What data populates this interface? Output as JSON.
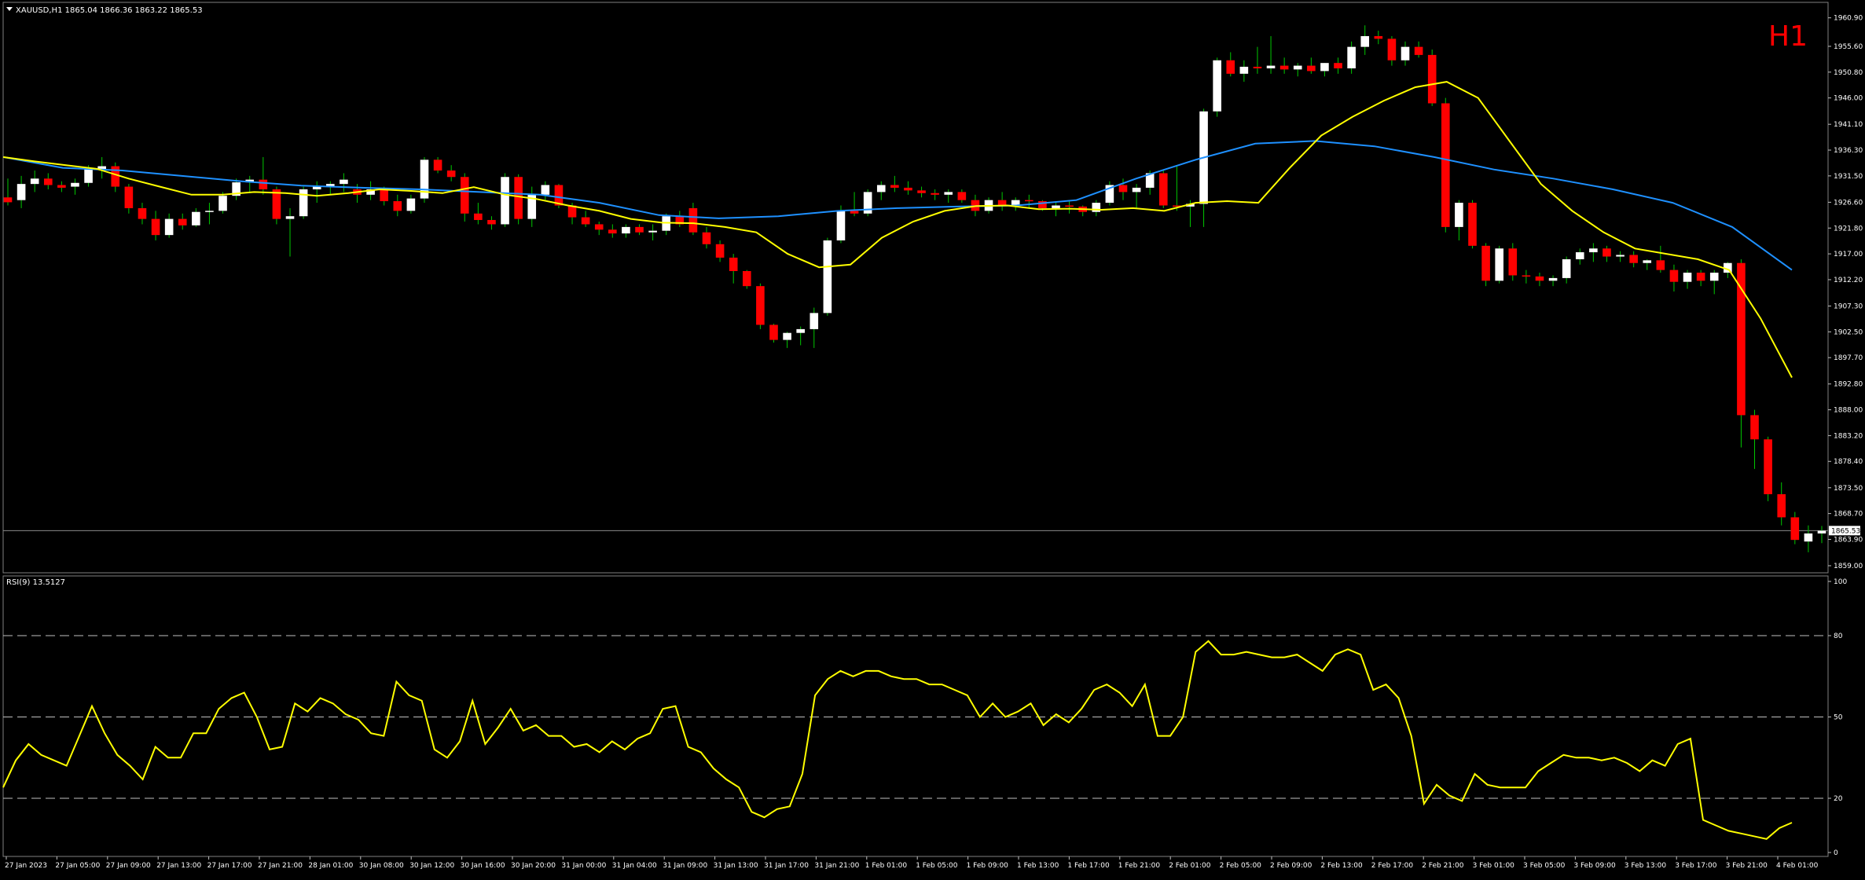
{
  "header": {
    "symbol_line": "XAUUSD,H1  1865.04 1866.36 1863.22 1865.53",
    "timeframe": "H1"
  },
  "price_axis": {
    "ticks": [
      "1960.90",
      "1955.60",
      "1950.80",
      "1946.00",
      "1941.10",
      "1936.30",
      "1931.50",
      "1926.60",
      "1921.80",
      "1917.00",
      "1912.20",
      "1907.30",
      "1902.50",
      "1897.70",
      "1892.80",
      "1888.00",
      "1883.20",
      "1878.40",
      "1873.50",
      "1868.70",
      "1863.90",
      "1859.00"
    ],
    "current_price": "1865.53"
  },
  "rsi": {
    "label": "RSI(9) 13.5127",
    "ticks": [
      "100",
      "80",
      "50",
      "20",
      "0"
    ],
    "levels": [
      80,
      50,
      20
    ]
  },
  "time_axis": {
    "labels": [
      "27 Jan 2023",
      "27 Jan 05:00",
      "27 Jan 09:00",
      "27 Jan 13:00",
      "27 Jan 17:00",
      "27 Jan 21:00",
      "28 Jan 01:00",
      "30 Jan 08:00",
      "30 Jan 12:00",
      "30 Jan 16:00",
      "30 Jan 20:00",
      "31 Jan 00:00",
      "31 Jan 04:00",
      "31 Jan 09:00",
      "31 Jan 13:00",
      "31 Jan 17:00",
      "31 Jan 21:00",
      "1 Feb 01:00",
      "1 Feb 05:00",
      "1 Feb 09:00",
      "1 Feb 13:00",
      "1 Feb 17:00",
      "1 Feb 21:00",
      "2 Feb 01:00",
      "2 Feb 05:00",
      "2 Feb 09:00",
      "2 Feb 13:00",
      "2 Feb 17:00",
      "2 Feb 21:00",
      "3 Feb 01:00",
      "3 Feb 05:00",
      "3 Feb 09:00",
      "3 Feb 13:00",
      "3 Feb 17:00",
      "3 Feb 21:00",
      "4 Feb 01:00"
    ]
  },
  "colors": {
    "background": "#000000",
    "bull_candle": "#ffffff",
    "bear_candle": "#ff0000",
    "wick": "#00c800",
    "fast_ma": "#ffff00",
    "slow_ma": "#1e90ff",
    "rsi_line": "#ffff00",
    "timeframe_label": "#ff0000",
    "grid_level": "#c0c0c0"
  },
  "chart_data": {
    "type": "candlestick",
    "symbol": "XAUUSD",
    "timeframe": "H1",
    "ylim": [
      1859.0,
      1962.0
    ],
    "candles": [
      [
        1927.5,
        1931.0,
        1926.0,
        1926.6
      ],
      [
        1927.0,
        1931.5,
        1925.5,
        1930.0
      ],
      [
        1930.0,
        1932.5,
        1928.5,
        1931.0
      ],
      [
        1931.0,
        1932.0,
        1929.0,
        1929.8
      ],
      [
        1929.8,
        1930.5,
        1928.5,
        1929.3
      ],
      [
        1929.5,
        1931.0,
        1928.0,
        1930.2
      ],
      [
        1930.2,
        1933.5,
        1929.5,
        1932.8
      ],
      [
        1932.8,
        1935.0,
        1931.0,
        1933.3
      ],
      [
        1933.3,
        1934.0,
        1928.5,
        1929.5
      ],
      [
        1929.5,
        1930.0,
        1924.5,
        1925.5
      ],
      [
        1925.5,
        1926.5,
        1922.5,
        1923.5
      ],
      [
        1923.5,
        1925.0,
        1919.5,
        1920.5
      ],
      [
        1920.5,
        1924.5,
        1920.0,
        1923.5
      ],
      [
        1923.5,
        1924.5,
        1921.5,
        1922.3
      ],
      [
        1922.3,
        1925.5,
        1922.0,
        1924.8
      ],
      [
        1924.8,
        1926.5,
        1922.5,
        1925.0
      ],
      [
        1925.0,
        1928.5,
        1924.5,
        1927.8
      ],
      [
        1927.8,
        1931.0,
        1927.0,
        1930.3
      ],
      [
        1930.3,
        1931.5,
        1928.5,
        1930.8
      ],
      [
        1930.8,
        1935.0,
        1928.0,
        1929.0
      ],
      [
        1929.0,
        1929.5,
        1922.5,
        1923.5
      ],
      [
        1923.5,
        1925.5,
        1916.5,
        1924.0
      ],
      [
        1924.0,
        1929.5,
        1923.5,
        1929.0
      ],
      [
        1929.0,
        1930.5,
        1926.5,
        1929.5
      ],
      [
        1929.5,
        1930.5,
        1928.0,
        1930.0
      ],
      [
        1930.0,
        1932.0,
        1928.5,
        1930.8
      ],
      [
        1929.0,
        1930.0,
        1926.5,
        1928.0
      ],
      [
        1928.0,
        1930.5,
        1927.0,
        1929.0
      ],
      [
        1929.0,
        1929.5,
        1926.0,
        1926.8
      ],
      [
        1926.8,
        1928.0,
        1924.0,
        1925.0
      ],
      [
        1925.0,
        1928.0,
        1924.5,
        1927.3
      ],
      [
        1927.3,
        1935.0,
        1926.5,
        1934.5
      ],
      [
        1934.5,
        1935.0,
        1932.0,
        1932.5
      ],
      [
        1932.5,
        1933.5,
        1930.5,
        1931.3
      ],
      [
        1931.3,
        1932.0,
        1923.0,
        1924.5
      ],
      [
        1924.5,
        1926.5,
        1922.5,
        1923.3
      ],
      [
        1923.3,
        1924.0,
        1921.5,
        1922.5
      ],
      [
        1922.5,
        1932.0,
        1922.0,
        1931.3
      ],
      [
        1931.3,
        1931.8,
        1922.5,
        1923.5
      ],
      [
        1923.5,
        1929.5,
        1922.0,
        1928.0
      ],
      [
        1928.0,
        1930.5,
        1927.0,
        1929.8
      ],
      [
        1929.8,
        1930.0,
        1925.5,
        1926.0
      ],
      [
        1926.0,
        1926.5,
        1922.5,
        1923.8
      ],
      [
        1923.8,
        1925.0,
        1922.0,
        1922.5
      ],
      [
        1922.5,
        1923.0,
        1920.5,
        1921.5
      ],
      [
        1921.5,
        1922.5,
        1920.0,
        1920.8
      ],
      [
        1920.8,
        1922.5,
        1920.0,
        1922.0
      ],
      [
        1922.0,
        1922.5,
        1920.5,
        1921.0
      ],
      [
        1921.0,
        1922.5,
        1919.5,
        1921.3
      ],
      [
        1921.3,
        1924.5,
        1920.5,
        1924.0
      ],
      [
        1924.0,
        1925.0,
        1922.0,
        1922.5
      ],
      [
        1925.5,
        1926.5,
        1920.5,
        1921.0
      ],
      [
        1921.0,
        1922.0,
        1918.0,
        1918.8
      ],
      [
        1918.8,
        1919.5,
        1915.5,
        1916.3
      ],
      [
        1916.3,
        1917.0,
        1911.5,
        1913.8
      ],
      [
        1913.8,
        1914.0,
        1910.5,
        1911.0
      ],
      [
        1911.0,
        1911.5,
        1903.0,
        1903.8
      ],
      [
        1903.8,
        1904.0,
        1900.5,
        1901.0
      ],
      [
        1901.0,
        1902.5,
        1899.5,
        1902.3
      ],
      [
        1902.3,
        1903.5,
        1900.0,
        1903.0
      ],
      [
        1903.0,
        1907.0,
        1899.5,
        1906.0
      ],
      [
        1906.0,
        1920.0,
        1905.5,
        1919.5
      ],
      [
        1919.5,
        1926.0,
        1919.0,
        1925.0
      ],
      [
        1925.0,
        1928.5,
        1924.0,
        1924.5
      ],
      [
        1924.5,
        1929.0,
        1924.0,
        1928.5
      ],
      [
        1928.5,
        1930.5,
        1927.0,
        1929.8
      ],
      [
        1929.8,
        1931.5,
        1928.5,
        1929.3
      ],
      [
        1929.3,
        1930.5,
        1928.0,
        1928.8
      ],
      [
        1928.8,
        1929.5,
        1927.5,
        1928.3
      ],
      [
        1928.3,
        1929.0,
        1927.0,
        1928.0
      ],
      [
        1928.0,
        1929.0,
        1926.5,
        1928.5
      ],
      [
        1928.5,
        1929.0,
        1926.5,
        1927.0
      ],
      [
        1927.0,
        1928.0,
        1924.0,
        1925.0
      ],
      [
        1925.0,
        1927.5,
        1924.5,
        1927.0
      ],
      [
        1927.0,
        1928.5,
        1925.0,
        1926.0
      ],
      [
        1926.0,
        1927.5,
        1925.0,
        1927.0
      ],
      [
        1927.0,
        1928.0,
        1925.5,
        1926.8
      ],
      [
        1926.8,
        1927.0,
        1925.0,
        1925.5
      ],
      [
        1925.5,
        1926.5,
        1924.0,
        1926.0
      ],
      [
        1926.0,
        1927.0,
        1924.5,
        1925.8
      ],
      [
        1925.8,
        1926.0,
        1924.0,
        1924.8
      ],
      [
        1924.8,
        1927.0,
        1924.0,
        1926.5
      ],
      [
        1926.5,
        1930.5,
        1926.0,
        1929.8
      ],
      [
        1929.8,
        1931.0,
        1927.0,
        1928.5
      ],
      [
        1928.5,
        1930.0,
        1925.5,
        1929.3
      ],
      [
        1929.3,
        1932.5,
        1928.0,
        1932.0
      ],
      [
        1932.0,
        1932.5,
        1925.5,
        1926.0
      ],
      [
        1926.0,
        1933.5,
        1925.0,
        1925.8
      ],
      [
        1925.8,
        1927.0,
        1922.0,
        1926.3
      ],
      [
        1926.3,
        1944.0,
        1922.0,
        1943.5
      ],
      [
        1943.5,
        1953.5,
        1942.5,
        1953.0
      ],
      [
        1953.0,
        1954.5,
        1950.0,
        1950.5
      ],
      [
        1950.5,
        1953.0,
        1949.0,
        1951.8
      ],
      [
        1951.8,
        1955.5,
        1950.5,
        1951.5
      ],
      [
        1951.5,
        1957.5,
        1950.5,
        1952.0
      ],
      [
        1952.0,
        1953.5,
        1950.5,
        1951.3
      ],
      [
        1951.3,
        1952.5,
        1950.0,
        1952.0
      ],
      [
        1952.0,
        1953.5,
        1950.5,
        1951.0
      ],
      [
        1951.0,
        1952.5,
        1950.0,
        1952.5
      ],
      [
        1952.5,
        1953.5,
        1950.5,
        1951.5
      ],
      [
        1951.5,
        1956.5,
        1950.5,
        1955.5
      ],
      [
        1955.5,
        1959.5,
        1954.0,
        1957.5
      ],
      [
        1957.5,
        1958.5,
        1956.0,
        1957.0
      ],
      [
        1957.0,
        1957.5,
        1952.0,
        1953.0
      ],
      [
        1953.0,
        1956.5,
        1952.0,
        1955.5
      ],
      [
        1955.5,
        1956.5,
        1953.5,
        1954.0
      ],
      [
        1954.0,
        1955.0,
        1944.5,
        1945.0
      ],
      [
        1945.0,
        1946.0,
        1921.0,
        1922.0
      ],
      [
        1922.0,
        1927.0,
        1919.5,
        1926.5
      ],
      [
        1926.5,
        1927.0,
        1918.0,
        1918.5
      ],
      [
        1918.5,
        1919.0,
        1911.0,
        1912.0
      ],
      [
        1912.0,
        1918.5,
        1911.5,
        1918.0
      ],
      [
        1918.0,
        1919.0,
        1912.0,
        1913.0
      ],
      [
        1913.0,
        1914.0,
        1911.5,
        1912.8
      ],
      [
        1912.8,
        1913.5,
        1911.0,
        1912.0
      ],
      [
        1912.0,
        1913.0,
        1911.0,
        1912.5
      ],
      [
        1912.5,
        1916.5,
        1911.5,
        1916.0
      ],
      [
        1916.0,
        1918.0,
        1915.0,
        1917.3
      ],
      [
        1917.3,
        1919.0,
        1915.5,
        1918.0
      ],
      [
        1918.0,
        1918.5,
        1915.5,
        1916.5
      ],
      [
        1916.5,
        1917.5,
        1915.5,
        1916.8
      ],
      [
        1916.8,
        1917.5,
        1914.5,
        1915.3
      ],
      [
        1915.3,
        1916.0,
        1914.0,
        1915.8
      ],
      [
        1915.8,
        1918.5,
        1913.5,
        1914.0
      ],
      [
        1914.0,
        1915.0,
        1910.0,
        1911.8
      ],
      [
        1911.8,
        1914.0,
        1910.5,
        1913.5
      ],
      [
        1913.5,
        1914.0,
        1911.0,
        1912.0
      ],
      [
        1912.0,
        1914.0,
        1909.5,
        1913.5
      ],
      [
        1913.5,
        1915.5,
        1912.5,
        1915.3
      ],
      [
        1915.3,
        1916.0,
        1881.0,
        1887.0
      ],
      [
        1887.0,
        1888.0,
        1877.0,
        1882.5
      ],
      [
        1882.5,
        1883.0,
        1871.0,
        1872.3
      ],
      [
        1872.3,
        1874.5,
        1866.5,
        1868.0
      ],
      [
        1868.0,
        1869.0,
        1863.0,
        1863.8
      ],
      [
        1863.5,
        1866.5,
        1861.5,
        1865.0
      ],
      [
        1865.0,
        1866.4,
        1863.2,
        1865.5
      ]
    ],
    "fast_ma": [
      1935.0,
      1934.2,
      1933.5,
      1932.8,
      1931.0,
      1929.5,
      1928.0,
      1928.0,
      1928.5,
      1928.3,
      1927.8,
      1928.3,
      1929.0,
      1928.7,
      1928.3,
      1929.4,
      1928.0,
      1927.2,
      1926.0,
      1925.0,
      1923.5,
      1922.8,
      1922.7,
      1922.0,
      1921.0,
      1917.0,
      1914.5,
      1915.0,
      1920.0,
      1923.0,
      1925.0,
      1925.9,
      1926.0,
      1925.3,
      1925.4,
      1925.2,
      1925.5,
      1925.0,
      1926.5,
      1926.8,
      1926.5,
      1933.0,
      1939.0,
      1942.5,
      1945.5,
      1948.0,
      1949.0,
      1946.0,
      1938.0,
      1930.0,
      1925.0,
      1921.0,
      1918.0,
      1917.0,
      1916.0,
      1914.0,
      1905.0,
      1894.0
    ],
    "slow_ma": [
      1935.0,
      1933.0,
      1932.5,
      1931.5,
      1930.5,
      1929.7,
      1929.3,
      1929.0,
      1928.5,
      1928.0,
      1926.5,
      1924.2,
      1923.6,
      1924.0,
      1925.0,
      1925.5,
      1925.8,
      1926.0,
      1927.0,
      1931.0,
      1934.5,
      1937.5,
      1938.0,
      1937.0,
      1935.0,
      1932.7,
      1931.0,
      1929.0,
      1926.5,
      1922.0,
      1914.0
    ],
    "rsi_values": [
      24,
      34,
      40,
      36,
      34,
      32,
      43,
      54,
      44,
      36,
      32,
      27,
      39,
      35,
      35,
      44,
      44,
      53,
      57,
      59,
      50,
      38,
      39,
      55,
      52,
      57,
      55,
      51,
      49,
      44,
      43,
      63,
      58,
      56,
      38,
      35,
      41,
      56,
      40,
      46,
      53,
      45,
      47,
      43,
      43,
      39,
      40,
      37,
      41,
      38,
      42,
      44,
      53,
      54,
      39,
      37,
      31,
      27,
      24,
      15,
      13,
      16,
      17,
      29,
      58,
      64,
      67,
      65,
      67,
      67,
      65,
      64,
      64,
      62,
      62,
      60,
      58,
      50,
      55,
      50,
      52,
      55,
      47,
      51,
      48,
      53,
      60,
      62,
      59,
      54,
      62,
      43,
      43,
      50,
      74,
      78,
      73,
      73,
      74,
      73,
      72,
      72,
      73,
      70,
      67,
      73,
      75,
      73,
      60,
      62,
      57,
      43,
      18,
      25,
      21,
      19,
      29,
      25,
      24,
      24,
      24,
      30,
      33,
      36,
      35,
      35,
      34,
      35,
      33,
      30,
      34,
      32,
      40,
      42,
      12,
      10,
      8,
      7,
      6,
      5,
      9,
      11
    ],
    "price_ticks": [
      1960.9,
      1955.6,
      1950.8,
      1946.0,
      1941.1,
      1936.3,
      1931.5,
      1926.6,
      1921.8,
      1917.0,
      1912.2,
      1907.3,
      1902.5,
      1897.7,
      1892.8,
      1888.0,
      1883.2,
      1878.4,
      1873.5,
      1868.7,
      1863.9,
      1859.0
    ]
  }
}
